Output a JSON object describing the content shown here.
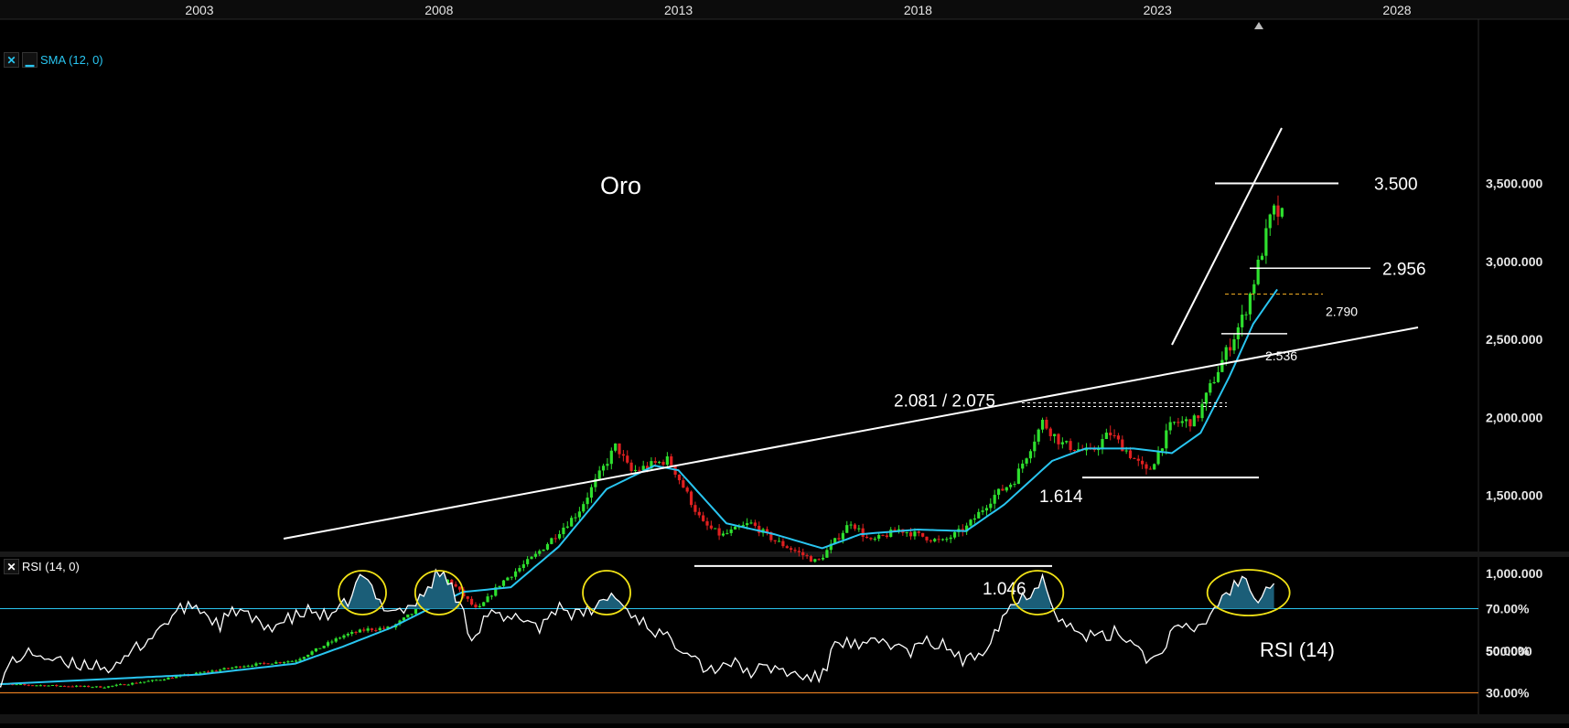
{
  "chart_data": [
    {
      "type": "candlestick",
      "title": "Oro",
      "x_tick_labels": [
        "2003",
        "2008",
        "2013",
        "2018",
        "2023",
        "2028"
      ],
      "y_tick_labels": [
        "3,500.000",
        "3,000.000",
        "2,500.000",
        "2,000.000",
        "1,500.000",
        "1,000.000",
        "500.000"
      ],
      "ylim": [
        250,
        3800
      ],
      "xlim": [
        1998.5,
        2030.8
      ],
      "indicator_label": "SMA (12, 0)",
      "annotations": [
        {
          "text": "3.500",
          "y": 3500
        },
        {
          "text": "2.956",
          "y": 2956
        },
        {
          "text": "2.790",
          "y": 2790
        },
        {
          "text": "2.536",
          "y": 2536
        },
        {
          "text": "2.081 / 2.075",
          "y": 2081
        },
        {
          "text": "1.614",
          "y": 1614
        },
        {
          "text": "1.046",
          "y": 1046
        }
      ],
      "price_anchors": [
        [
          1998.6,
          290
        ],
        [
          2001.0,
          270
        ],
        [
          2002.0,
          310
        ],
        [
          2003.0,
          360
        ],
        [
          2004.0,
          410
        ],
        [
          2005.0,
          440
        ],
        [
          2006.0,
          600
        ],
        [
          2006.5,
          640
        ],
        [
          2007.0,
          650
        ],
        [
          2007.8,
          820
        ],
        [
          2008.2,
          960
        ],
        [
          2008.8,
          760
        ],
        [
          2009.3,
          940
        ],
        [
          2010.0,
          1110
        ],
        [
          2010.9,
          1390
        ],
        [
          2011.7,
          1820
        ],
        [
          2012.0,
          1650
        ],
        [
          2012.8,
          1730
        ],
        [
          2013.5,
          1320
        ],
        [
          2013.9,
          1240
        ],
        [
          2014.5,
          1320
        ],
        [
          2015.0,
          1210
        ],
        [
          2015.9,
          1070
        ],
        [
          2016.6,
          1330
        ],
        [
          2017.0,
          1200
        ],
        [
          2017.6,
          1280
        ],
        [
          2018.5,
          1200
        ],
        [
          2019.0,
          1290
        ],
        [
          2019.6,
          1500
        ],
        [
          2020.0,
          1590
        ],
        [
          2020.6,
          1970
        ],
        [
          2021.0,
          1830
        ],
        [
          2021.6,
          1770
        ],
        [
          2022.0,
          1900
        ],
        [
          2022.8,
          1640
        ],
        [
          2023.3,
          1960
        ],
        [
          2023.8,
          1980
        ],
        [
          2024.3,
          2330
        ],
        [
          2024.8,
          2650
        ],
        [
          2025.0,
          2860
        ],
        [
          2025.4,
          3320
        ],
        [
          2025.6,
          3290
        ]
      ],
      "sma_anchors": [
        [
          1998.6,
          285
        ],
        [
          2003.0,
          350
        ],
        [
          2005.0,
          420
        ],
        [
          2006.0,
          530
        ],
        [
          2007.0,
          650
        ],
        [
          2008.5,
          880
        ],
        [
          2009.5,
          910
        ],
        [
          2010.5,
          1170
        ],
        [
          2011.5,
          1540
        ],
        [
          2012.5,
          1690
        ],
        [
          2013.0,
          1660
        ],
        [
          2014.0,
          1320
        ],
        [
          2015.0,
          1250
        ],
        [
          2016.0,
          1160
        ],
        [
          2016.8,
          1250
        ],
        [
          2018.0,
          1280
        ],
        [
          2019.0,
          1270
        ],
        [
          2019.8,
          1440
        ],
        [
          2020.8,
          1720
        ],
        [
          2021.5,
          1800
        ],
        [
          2022.5,
          1800
        ],
        [
          2023.3,
          1770
        ],
        [
          2023.9,
          1900
        ],
        [
          2024.5,
          2260
        ],
        [
          2025.0,
          2600
        ],
        [
          2025.5,
          2820
        ]
      ]
    },
    {
      "type": "line",
      "title": "RSI (14)",
      "indicator_label": "RSI (14, 0)",
      "y_tick_labels": [
        "70.00%",
        "50.00%",
        "30.00%"
      ],
      "ylim": [
        15,
        90
      ],
      "overbought": 70,
      "oversold": 30,
      "rsi_anchors": [
        [
          1998.6,
          34
        ],
        [
          1998.8,
          31
        ],
        [
          1999.1,
          46
        ],
        [
          1999.6,
          49
        ],
        [
          2000.2,
          43
        ],
        [
          2000.8,
          44
        ],
        [
          2001.3,
          41
        ],
        [
          2001.6,
          50
        ],
        [
          2002.0,
          57
        ],
        [
          2002.5,
          68
        ],
        [
          2002.9,
          72
        ],
        [
          2003.4,
          62
        ],
        [
          2003.8,
          70
        ],
        [
          2004.3,
          61
        ],
        [
          2004.8,
          64
        ],
        [
          2005.3,
          69
        ],
        [
          2005.8,
          65
        ],
        [
          2006.1,
          74
        ],
        [
          2006.4,
          86
        ],
        [
          2006.8,
          72
        ],
        [
          2007.2,
          69
        ],
        [
          2007.6,
          74
        ],
        [
          2008.0,
          88
        ],
        [
          2008.3,
          79
        ],
        [
          2008.7,
          56
        ],
        [
          2009.0,
          68
        ],
        [
          2009.4,
          64
        ],
        [
          2009.8,
          66
        ],
        [
          2010.1,
          61
        ],
        [
          2010.5,
          72
        ],
        [
          2010.9,
          66
        ],
        [
          2011.3,
          71
        ],
        [
          2011.6,
          77
        ],
        [
          2011.9,
          70
        ],
        [
          2012.3,
          63
        ],
        [
          2012.8,
          55
        ],
        [
          2013.3,
          50
        ],
        [
          2013.6,
          40
        ],
        [
          2014.0,
          45
        ],
        [
          2014.5,
          40
        ],
        [
          2015.0,
          42
        ],
        [
          2015.5,
          38
        ],
        [
          2016.0,
          37
        ],
        [
          2016.3,
          56
        ],
        [
          2016.8,
          51
        ],
        [
          2017.3,
          55
        ],
        [
          2017.8,
          49
        ],
        [
          2018.2,
          54
        ],
        [
          2018.6,
          52
        ],
        [
          2019.0,
          44
        ],
        [
          2019.4,
          52
        ],
        [
          2019.9,
          71
        ],
        [
          2020.3,
          77
        ],
        [
          2020.6,
          85
        ],
        [
          2020.9,
          68
        ],
        [
          2021.3,
          58
        ],
        [
          2021.8,
          56
        ],
        [
          2022.2,
          59
        ],
        [
          2022.6,
          52
        ],
        [
          2022.9,
          44
        ],
        [
          2023.3,
          59
        ],
        [
          2023.9,
          61
        ],
        [
          2024.4,
          77
        ],
        [
          2024.8,
          85
        ],
        [
          2025.1,
          76
        ],
        [
          2025.5,
          86
        ]
      ]
    }
  ]
}
